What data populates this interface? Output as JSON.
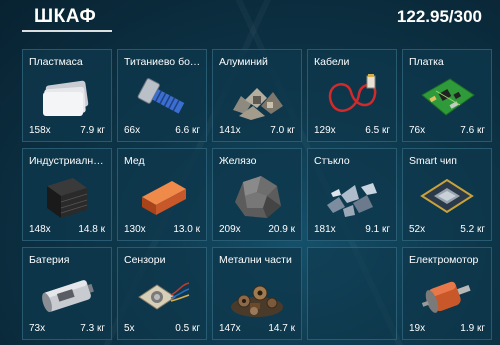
{
  "header": {
    "title": "ШКАФ",
    "capacity": "122.95/300"
  },
  "items": [
    {
      "name": "Пластмаса",
      "qty": "158x",
      "weight": "7.9 кг",
      "icon": "plastic-sheets-icon"
    },
    {
      "name": "Титаниево болт...",
      "qty": "66x",
      "weight": "6.6 кг",
      "icon": "titanium-bolt-icon"
    },
    {
      "name": "Алуминий",
      "qty": "141x",
      "weight": "7.0 кг",
      "icon": "aluminum-scrap-icon"
    },
    {
      "name": "Кабели",
      "qty": "129x",
      "weight": "6.5 кг",
      "icon": "cable-icon"
    },
    {
      "name": "Платка",
      "qty": "76x",
      "weight": "7.6 кг",
      "icon": "circuit-board-icon"
    },
    {
      "name": "Индустриална г...",
      "qty": "148x",
      "weight": "14.8 к",
      "icon": "industrial-rubber-icon"
    },
    {
      "name": "Мед",
      "qty": "130x",
      "weight": "13.0 к",
      "icon": "copper-ingot-icon"
    },
    {
      "name": "Желязо",
      "qty": "209x",
      "weight": "20.9 к",
      "icon": "iron-ore-icon"
    },
    {
      "name": "Стъкло",
      "qty": "181x",
      "weight": "9.1 кг",
      "icon": "glass-shards-icon"
    },
    {
      "name": "Smart чип",
      "qty": "52x",
      "weight": "5.2 кг",
      "icon": "smart-chip-icon"
    },
    {
      "name": "Батерия",
      "qty": "73x",
      "weight": "7.3 кг",
      "icon": "battery-icon"
    },
    {
      "name": "Сензори",
      "qty": "5x",
      "weight": "0.5 кг",
      "icon": "sensor-icon"
    },
    {
      "name": "Метални части",
      "qty": "147x",
      "weight": "14.7 к",
      "icon": "metal-parts-icon"
    },
    {
      "name": "",
      "qty": "",
      "weight": "",
      "icon": ""
    },
    {
      "name": "Електромотор",
      "qty": "19x",
      "weight": "1.9 кг",
      "icon": "electric-motor-icon"
    }
  ]
}
